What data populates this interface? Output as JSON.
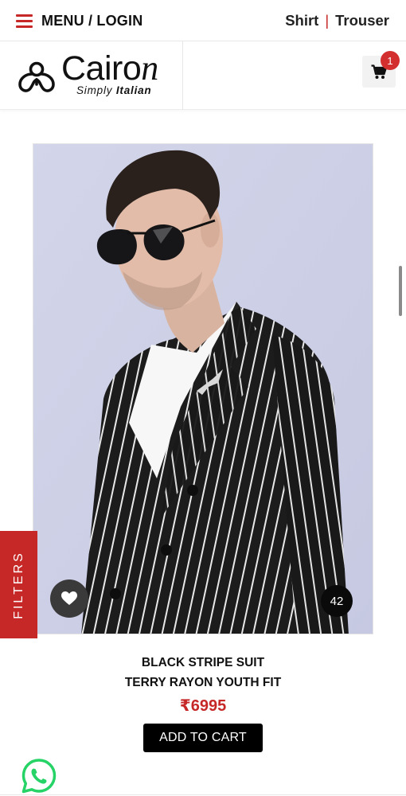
{
  "topbar": {
    "menu_label": "MENU / LOGIN",
    "links": [
      "Shirt",
      "Trouser"
    ],
    "separator": "|"
  },
  "brand": {
    "name_plain": "Cairo",
    "name_italic": "n",
    "tagline_plain": "Simply ",
    "tagline_bold": "Italian"
  },
  "cart": {
    "icon": "shopping-cart-icon",
    "count": "1"
  },
  "filters_label": "FILTERS",
  "product": {
    "photo": "man in black pinstripe suit with sunglasses",
    "name_line1": "BLACK STRIPE SUIT",
    "name_line2": "TERRY RAYON YOUTH FIT",
    "currency": "₹",
    "price": "6995",
    "size": "42",
    "add_to_cart_label": "ADD TO CART",
    "wishlist_icon": "heart-icon"
  },
  "colors": {
    "accent": "#c62828",
    "badge": "#d32f2f",
    "button": "#000000",
    "whatsapp": "#25d366"
  }
}
